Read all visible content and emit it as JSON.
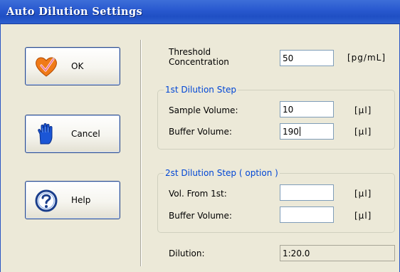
{
  "window": {
    "title": "Auto Dilution Settings"
  },
  "buttons": {
    "ok": {
      "label": "OK",
      "icon": "heart-check-icon"
    },
    "cancel": {
      "label": "Cancel",
      "icon": "hand-icon"
    },
    "help": {
      "label": "Help",
      "icon": "question-icon"
    }
  },
  "threshold": {
    "label_line1": "Threshold",
    "label_line2": "Concentration",
    "value": "50",
    "unit": "[pg/mL]"
  },
  "step1": {
    "legend": "1st Dilution Step",
    "sample_label": "Sample Volume:",
    "sample_value": "10",
    "sample_unit": "[μl]",
    "buffer_label": "Buffer Volume:",
    "buffer_value": "190",
    "buffer_unit": "[μl]"
  },
  "step2": {
    "legend": "2st Dilution Step ( option )",
    "vol_label": "Vol. From 1st:",
    "vol_value": "",
    "vol_unit": "[μl]",
    "buffer_label": "Buffer Volume:",
    "buffer_value": "",
    "buffer_unit": "[μl]"
  },
  "dilution": {
    "label": "Dilution:",
    "value": "1:20.0"
  },
  "colors": {
    "titlebar": "#2a5ad0",
    "legend_text": "#0046d5",
    "face": "#ece9d8"
  }
}
